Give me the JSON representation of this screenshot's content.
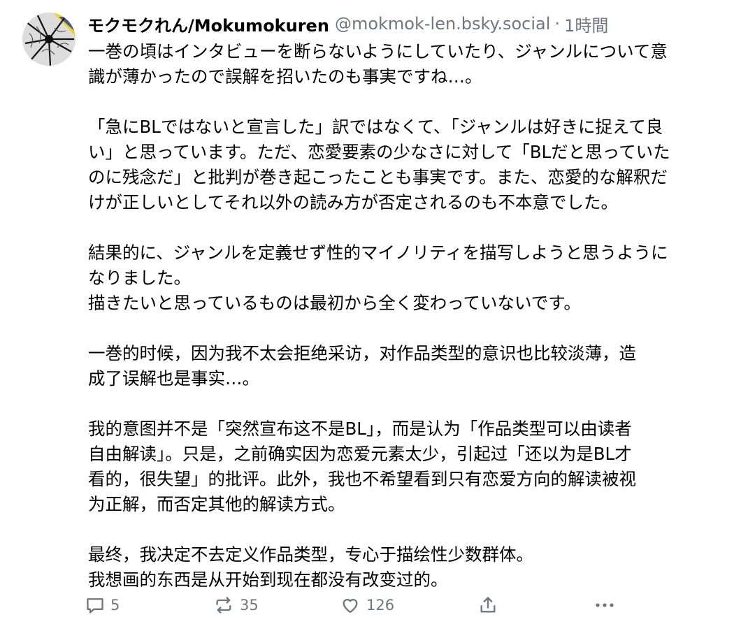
{
  "post": {
    "display_name": "モクモクれん/Mokumokuren",
    "handle": "@mokmok-len.bsky.social",
    "separator": "·",
    "time": "1時間",
    "paragraphs": [
      [
        "一巻の頃はインタビューを断らないようにしていたり、ジャンルについて意",
        "識が薄かったので誤解を招いたのも事実ですね…。"
      ],
      [
        "「急にBLではないと宣言した」訳ではなくて、「ジャンルは好きに捉えて良",
        "い」と思っています。ただ、恋愛要素の少なさに対して「BLだと思っていた",
        "のに残念だ」と批判が巻き起こったことも事実です。また、恋愛的な解釈だ",
        "けが正しいとしてそれ以外の読み方が否定されるのも不本意でした。"
      ],
      [
        "結果的に、ジャンルを定義せず性的マイノリティを描写しようと思うように",
        "なりました。",
        "描きたいと思っているものは最初から全く変わっていないです。"
      ],
      [
        "一巻的时候，因为我不太会拒绝采访，对作品类型的意识也比较淡薄，造",
        "成了误解也是事实…。"
      ],
      [
        "我的意图并不是「突然宣布这不是BL」，而是认为「作品类型可以由读者",
        "自由解读」。只是，之前确实因为恋爱元素太少，引起过「还以为是BL才",
        "看的，很失望」的批评。此外，我也不希望看到只有恋爱方向的解读被视",
        "为正解，而否定其他的解读方式。"
      ],
      [
        "最终，我决定不去定义作品类型，专心于描绘性少数群体。",
        "我想画的东西是从开始到现在都没有改变过的。"
      ]
    ]
  },
  "actions": {
    "reply_count": "5",
    "repost_count": "35",
    "like_count": "126"
  },
  "icons": {
    "reply": "reply-icon",
    "repost": "repost-icon",
    "like": "heart-icon",
    "share": "share-icon",
    "more": "more-icon"
  },
  "colors": {
    "text": "#000000",
    "muted": "#6e7781",
    "avatar_accent": "#f2d21b"
  }
}
